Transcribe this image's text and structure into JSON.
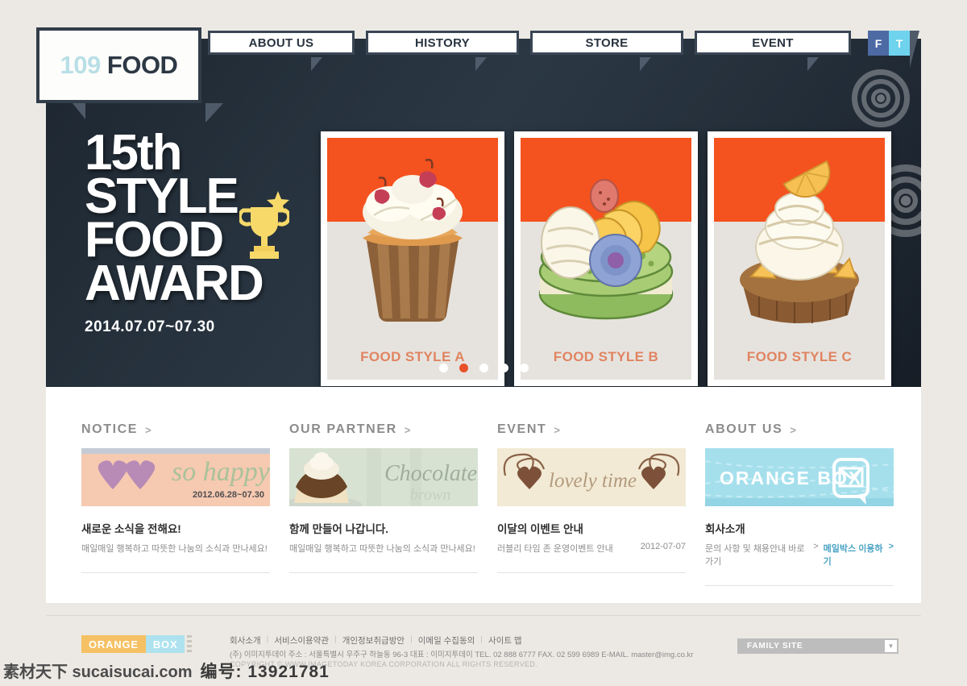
{
  "site": {
    "logo_num": "109",
    "logo_name": "FOOD"
  },
  "nav": {
    "items": [
      {
        "label": "ABOUT US"
      },
      {
        "label": "HISTORY"
      },
      {
        "label": "STORE"
      },
      {
        "label": "EVENT"
      }
    ],
    "social": [
      {
        "label": "F",
        "name": "facebook"
      },
      {
        "label": "T",
        "name": "twitter"
      }
    ]
  },
  "hero": {
    "line1": "15th",
    "line2": "STYLE",
    "line3": "FOOD",
    "line4": "AWARD",
    "date": "2014.07.07~07.30",
    "cards": [
      {
        "label": "FOOD STYLE A",
        "art": "cupcake-cherry"
      },
      {
        "label": "FOOD STYLE B",
        "art": "green-macaron"
      },
      {
        "label": "FOOD STYLE C",
        "art": "orange-tart"
      }
    ],
    "dots": [
      {
        "active": false
      },
      {
        "active": true
      },
      {
        "active": false
      },
      {
        "active": false
      },
      {
        "active": false
      }
    ],
    "band_color": "#f4521f",
    "label_color": "#e08461",
    "active_dot_color": "#e8512a"
  },
  "sections": [
    {
      "heading": "NOTICE",
      "arrow": ">",
      "thumb": {
        "kind": "so-happy",
        "script": "so happy",
        "date": "2012.06.28~07.30"
      },
      "title": "새로운 소식을 전해요!",
      "sub": "매일매일 행복하고 따뜻한 나눔의 소식과 만나세요!",
      "meta": ""
    },
    {
      "heading": "OUR PARTNER",
      "arrow": ">",
      "thumb": {
        "kind": "chocolate-brown",
        "script": "Chocolate",
        "script2": "brown"
      },
      "title": "함께 만들어 나갑니다.",
      "sub": "매일매일 행복하고 따뜻한 나눔의 소식과 만나세요!",
      "meta": ""
    },
    {
      "heading": "EVENT",
      "arrow": ">",
      "thumb": {
        "kind": "lovely-time",
        "script": "lovely time"
      },
      "title": "이달의 이벤트 안내",
      "sub": "러블리 타임 존 운영이벤트 안내",
      "meta": "2012-07-07"
    },
    {
      "heading": "ABOUT US",
      "arrow": ">",
      "thumb": {
        "kind": "orange-box",
        "script": "ORANGE BOX"
      },
      "title": "회사소개",
      "sub": "문의 사항 및 채용안내 바로가기",
      "sub_arrow": ">",
      "link": "메일박스 이용하기",
      "link_arrow": ">",
      "meta": ""
    }
  ],
  "footer": {
    "logo_o": "ORANGE",
    "logo_b": "BOX",
    "links": [
      "회사소개",
      "서비스이용약관",
      "개인정보취급방안",
      "이메일 수집동의",
      "사이트 맵"
    ],
    "separator": "|",
    "address": "(주) 이미지투데이    주소 : 서울특별시 우주구 하늘동 96-3   대표 : 이미지투데이   TEL. 02 888 6777  FAX. 02 599 6989  E-MAIL. master@img.co.kr",
    "copyright": "COPYRIGHT © WWW.IMAGETODAY KOREA CORPORATION ALL RIGHTS RESERVED.",
    "family_site": "FAMILY SITE",
    "family_arrow": "▼"
  },
  "watermark": {
    "text1": "素材天下 sucaisucai.com",
    "text2": "编号: 13921781"
  }
}
